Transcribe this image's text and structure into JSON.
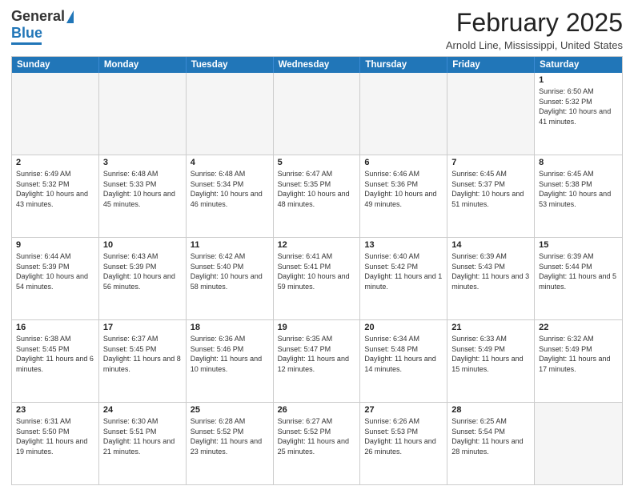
{
  "header": {
    "logo": {
      "line1": "General",
      "line2": "Blue"
    },
    "title": "February 2025",
    "location": "Arnold Line, Mississippi, United States"
  },
  "weekdays": [
    "Sunday",
    "Monday",
    "Tuesday",
    "Wednesday",
    "Thursday",
    "Friday",
    "Saturday"
  ],
  "weeks": [
    [
      {
        "day": "",
        "empty": true
      },
      {
        "day": "",
        "empty": true
      },
      {
        "day": "",
        "empty": true
      },
      {
        "day": "",
        "empty": true
      },
      {
        "day": "",
        "empty": true
      },
      {
        "day": "",
        "empty": true
      },
      {
        "day": "1",
        "sunrise": "Sunrise: 6:50 AM",
        "sunset": "Sunset: 5:32 PM",
        "daylight": "Daylight: 10 hours and 41 minutes."
      }
    ],
    [
      {
        "day": "2",
        "sunrise": "Sunrise: 6:49 AM",
        "sunset": "Sunset: 5:32 PM",
        "daylight": "Daylight: 10 hours and 43 minutes."
      },
      {
        "day": "3",
        "sunrise": "Sunrise: 6:48 AM",
        "sunset": "Sunset: 5:33 PM",
        "daylight": "Daylight: 10 hours and 45 minutes."
      },
      {
        "day": "4",
        "sunrise": "Sunrise: 6:48 AM",
        "sunset": "Sunset: 5:34 PM",
        "daylight": "Daylight: 10 hours and 46 minutes."
      },
      {
        "day": "5",
        "sunrise": "Sunrise: 6:47 AM",
        "sunset": "Sunset: 5:35 PM",
        "daylight": "Daylight: 10 hours and 48 minutes."
      },
      {
        "day": "6",
        "sunrise": "Sunrise: 6:46 AM",
        "sunset": "Sunset: 5:36 PM",
        "daylight": "Daylight: 10 hours and 49 minutes."
      },
      {
        "day": "7",
        "sunrise": "Sunrise: 6:45 AM",
        "sunset": "Sunset: 5:37 PM",
        "daylight": "Daylight: 10 hours and 51 minutes."
      },
      {
        "day": "8",
        "sunrise": "Sunrise: 6:45 AM",
        "sunset": "Sunset: 5:38 PM",
        "daylight": "Daylight: 10 hours and 53 minutes."
      }
    ],
    [
      {
        "day": "9",
        "sunrise": "Sunrise: 6:44 AM",
        "sunset": "Sunset: 5:39 PM",
        "daylight": "Daylight: 10 hours and 54 minutes."
      },
      {
        "day": "10",
        "sunrise": "Sunrise: 6:43 AM",
        "sunset": "Sunset: 5:39 PM",
        "daylight": "Daylight: 10 hours and 56 minutes."
      },
      {
        "day": "11",
        "sunrise": "Sunrise: 6:42 AM",
        "sunset": "Sunset: 5:40 PM",
        "daylight": "Daylight: 10 hours and 58 minutes."
      },
      {
        "day": "12",
        "sunrise": "Sunrise: 6:41 AM",
        "sunset": "Sunset: 5:41 PM",
        "daylight": "Daylight: 10 hours and 59 minutes."
      },
      {
        "day": "13",
        "sunrise": "Sunrise: 6:40 AM",
        "sunset": "Sunset: 5:42 PM",
        "daylight": "Daylight: 11 hours and 1 minute."
      },
      {
        "day": "14",
        "sunrise": "Sunrise: 6:39 AM",
        "sunset": "Sunset: 5:43 PM",
        "daylight": "Daylight: 11 hours and 3 minutes."
      },
      {
        "day": "15",
        "sunrise": "Sunrise: 6:39 AM",
        "sunset": "Sunset: 5:44 PM",
        "daylight": "Daylight: 11 hours and 5 minutes."
      }
    ],
    [
      {
        "day": "16",
        "sunrise": "Sunrise: 6:38 AM",
        "sunset": "Sunset: 5:45 PM",
        "daylight": "Daylight: 11 hours and 6 minutes."
      },
      {
        "day": "17",
        "sunrise": "Sunrise: 6:37 AM",
        "sunset": "Sunset: 5:45 PM",
        "daylight": "Daylight: 11 hours and 8 minutes."
      },
      {
        "day": "18",
        "sunrise": "Sunrise: 6:36 AM",
        "sunset": "Sunset: 5:46 PM",
        "daylight": "Daylight: 11 hours and 10 minutes."
      },
      {
        "day": "19",
        "sunrise": "Sunrise: 6:35 AM",
        "sunset": "Sunset: 5:47 PM",
        "daylight": "Daylight: 11 hours and 12 minutes."
      },
      {
        "day": "20",
        "sunrise": "Sunrise: 6:34 AM",
        "sunset": "Sunset: 5:48 PM",
        "daylight": "Daylight: 11 hours and 14 minutes."
      },
      {
        "day": "21",
        "sunrise": "Sunrise: 6:33 AM",
        "sunset": "Sunset: 5:49 PM",
        "daylight": "Daylight: 11 hours and 15 minutes."
      },
      {
        "day": "22",
        "sunrise": "Sunrise: 6:32 AM",
        "sunset": "Sunset: 5:49 PM",
        "daylight": "Daylight: 11 hours and 17 minutes."
      }
    ],
    [
      {
        "day": "23",
        "sunrise": "Sunrise: 6:31 AM",
        "sunset": "Sunset: 5:50 PM",
        "daylight": "Daylight: 11 hours and 19 minutes."
      },
      {
        "day": "24",
        "sunrise": "Sunrise: 6:30 AM",
        "sunset": "Sunset: 5:51 PM",
        "daylight": "Daylight: 11 hours and 21 minutes."
      },
      {
        "day": "25",
        "sunrise": "Sunrise: 6:28 AM",
        "sunset": "Sunset: 5:52 PM",
        "daylight": "Daylight: 11 hours and 23 minutes."
      },
      {
        "day": "26",
        "sunrise": "Sunrise: 6:27 AM",
        "sunset": "Sunset: 5:52 PM",
        "daylight": "Daylight: 11 hours and 25 minutes."
      },
      {
        "day": "27",
        "sunrise": "Sunrise: 6:26 AM",
        "sunset": "Sunset: 5:53 PM",
        "daylight": "Daylight: 11 hours and 26 minutes."
      },
      {
        "day": "28",
        "sunrise": "Sunrise: 6:25 AM",
        "sunset": "Sunset: 5:54 PM",
        "daylight": "Daylight: 11 hours and 28 minutes."
      },
      {
        "day": "",
        "empty": true
      }
    ]
  ]
}
